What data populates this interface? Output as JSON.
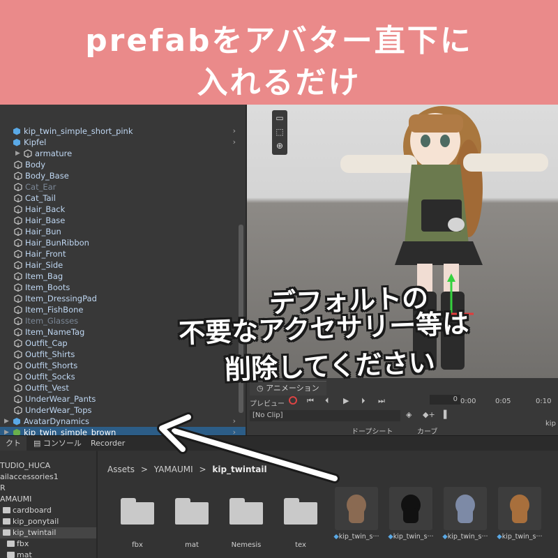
{
  "banner": {
    "line1": "prefabをアバター直下に",
    "line2": "入れるだけ",
    "background": "#ea8a8a"
  },
  "overlay_note": {
    "line1": "デフォルトの",
    "line2": "不要なアクセサリー等は",
    "line3": "削除してください"
  },
  "hierarchy": {
    "rows": [
      {
        "label": "kip_twin_simple_short_pink",
        "dim": false,
        "level": 0,
        "expander": "",
        "chevron": true
      },
      {
        "label": "Kipfel",
        "dim": false,
        "level": 0,
        "expander": "",
        "chevron": true
      },
      {
        "label": "armature",
        "dim": false,
        "level": 1,
        "expander": "▶",
        "chevron": false
      },
      {
        "label": "Body",
        "dim": false,
        "level": 1,
        "expander": "",
        "chevron": false
      },
      {
        "label": "Body_Base",
        "dim": false,
        "level": 1,
        "expander": "",
        "chevron": false
      },
      {
        "label": "Cat_Ear",
        "dim": true,
        "level": 1,
        "expander": "",
        "chevron": false
      },
      {
        "label": "Cat_Tail",
        "dim": false,
        "level": 1,
        "expander": "",
        "chevron": false
      },
      {
        "label": "Hair_Back",
        "dim": false,
        "level": 1,
        "expander": "",
        "chevron": false
      },
      {
        "label": "Hair_Base",
        "dim": false,
        "level": 1,
        "expander": "",
        "chevron": false
      },
      {
        "label": "Hair_Bun",
        "dim": false,
        "level": 1,
        "expander": "",
        "chevron": false
      },
      {
        "label": "Hair_BunRibbon",
        "dim": false,
        "level": 1,
        "expander": "",
        "chevron": false
      },
      {
        "label": "Hair_Front",
        "dim": false,
        "level": 1,
        "expander": "",
        "chevron": false
      },
      {
        "label": "Hair_Side",
        "dim": false,
        "level": 1,
        "expander": "",
        "chevron": false
      },
      {
        "label": "Item_Bag",
        "dim": false,
        "level": 1,
        "expander": "",
        "chevron": false
      },
      {
        "label": "Item_Boots",
        "dim": false,
        "level": 1,
        "expander": "",
        "chevron": false
      },
      {
        "label": "Item_DressingPad",
        "dim": false,
        "level": 1,
        "expander": "",
        "chevron": false
      },
      {
        "label": "Item_FishBone",
        "dim": false,
        "level": 1,
        "expander": "",
        "chevron": false
      },
      {
        "label": "Item_Glasses",
        "dim": true,
        "level": 1,
        "expander": "",
        "chevron": false
      },
      {
        "label": "Item_NameTag",
        "dim": false,
        "level": 1,
        "expander": "",
        "chevron": false
      },
      {
        "label": "Outfit_Cap",
        "dim": false,
        "level": 1,
        "expander": "",
        "chevron": false
      },
      {
        "label": "Outfit_Shirts",
        "dim": false,
        "level": 1,
        "expander": "",
        "chevron": false
      },
      {
        "label": "Outfit_Shorts",
        "dim": false,
        "level": 1,
        "expander": "",
        "chevron": false
      },
      {
        "label": "Outfit_Socks",
        "dim": false,
        "level": 1,
        "expander": "",
        "chevron": false
      },
      {
        "label": "Outfit_Vest",
        "dim": false,
        "level": 1,
        "expander": "",
        "chevron": false
      },
      {
        "label": "UnderWear_Pants",
        "dim": false,
        "level": 1,
        "expander": "",
        "chevron": false
      },
      {
        "label": "UnderWear_Tops",
        "dim": false,
        "level": 1,
        "expander": "",
        "chevron": false
      },
      {
        "label": "AvatarDynamics",
        "dim": false,
        "level": 0,
        "expander": "▶",
        "chevron": true
      },
      {
        "label": "kip_twin_simple_brown",
        "dim": false,
        "level": 0,
        "expander": "▶",
        "chevron": true,
        "selected": true
      }
    ]
  },
  "animation": {
    "tab_label": "アニメーション",
    "preview_label": "プレビュー",
    "frame_value": "0",
    "ticks": [
      "0:00",
      "0:05",
      "0:10"
    ],
    "clip_dropdown": "[No Clip]",
    "dopesheet_label": "ドープシート",
    "curves_label": "カーブ",
    "right_cut": "kip"
  },
  "bottom_tabs": {
    "project": "クト",
    "console": "コンソール",
    "recorder": "Recorder"
  },
  "project_tree": [
    {
      "label": "TUDIO_HUCA",
      "indent": 0
    },
    {
      "label": "ailaccessories1",
      "indent": 0
    },
    {
      "label": "R",
      "indent": 0
    },
    {
      "label": "AMAUMI",
      "indent": 0
    },
    {
      "label": "cardboard",
      "indent": 1
    },
    {
      "label": "kip_ponytail",
      "indent": 1
    },
    {
      "label": "kip_twintail",
      "indent": 1,
      "selected": true
    },
    {
      "label": "fbx",
      "indent": 2
    },
    {
      "label": "mat",
      "indent": 2
    }
  ],
  "breadcrumb": {
    "root": "Assets",
    "folder": "YAMAUMI",
    "current": "kip_twintail",
    "separator": ">"
  },
  "folders": [
    "fbx",
    "mat",
    "Nemesis",
    "tex"
  ],
  "prefabs": [
    {
      "label": "kip_twin_s···",
      "color": "#8a6a52"
    },
    {
      "label": "kip_twin_s···",
      "color": "#111111"
    },
    {
      "label": "kip_twin_s···",
      "color": "#7d8aa6"
    },
    {
      "label": "kip_twin_s···",
      "color": "#a86f3c"
    }
  ]
}
